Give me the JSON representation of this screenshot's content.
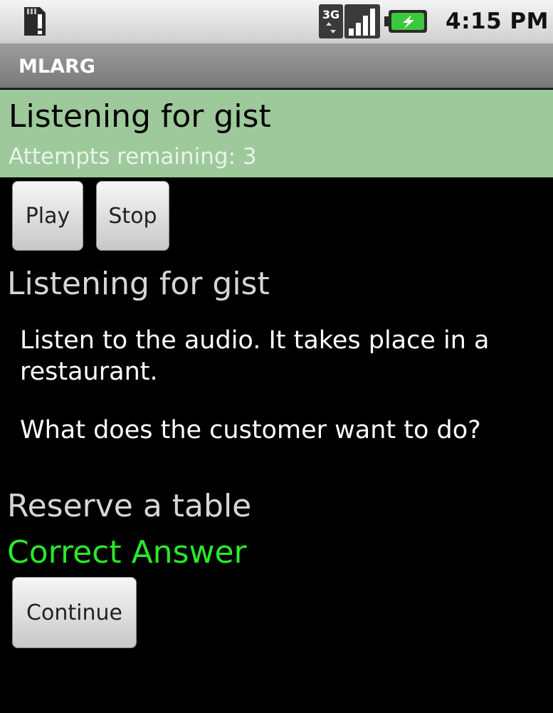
{
  "status_bar": {
    "time": "4:15 PM",
    "icons": [
      "sd-card-warning-icon",
      "3g-data-icon",
      "signal-strength-icon",
      "battery-charging-icon"
    ]
  },
  "app": {
    "title": "MLARG"
  },
  "header": {
    "title": "Listening for gist",
    "attempts": "Attempts remaining: 3",
    "background": "#9dc99b"
  },
  "controls": {
    "play_label": "Play",
    "stop_label": "Stop"
  },
  "content": {
    "section_title": "Listening for gist",
    "instruction": "Listen to the audio. It takes place in a restaurant.",
    "question": "What does the customer want to do?",
    "answer": "Reserve a table",
    "result": "Correct Answer",
    "result_color": "#2be82b",
    "continue_label": "Continue"
  }
}
